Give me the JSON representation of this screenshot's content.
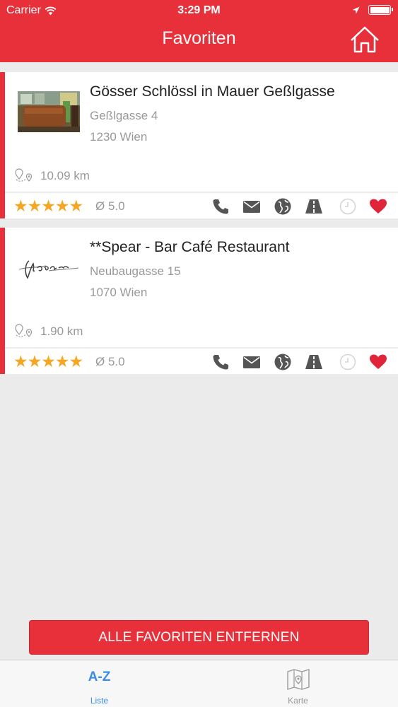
{
  "status_bar": {
    "carrier": "Carrier",
    "time": "3:29 PM"
  },
  "nav": {
    "title": "Favoriten",
    "home_icon": "home-icon"
  },
  "favorites": [
    {
      "name": "Gösser Schlössl in Mauer Geßlgasse",
      "street": "Geßlgasse 4",
      "city": "1230 Wien",
      "distance": "10.09 km",
      "stars": "★★★★★",
      "rating": 5.0,
      "rating_text": "Ø 5.0"
    },
    {
      "name": "**Spear - Bar Café Restaurant",
      "street": "Neubaugasse 15",
      "city": "1070 Wien",
      "distance": "1.90 km",
      "stars": "★★★★★",
      "rating": 5.0,
      "rating_text": "Ø 5.0"
    }
  ],
  "actions": [
    "phone-icon",
    "mail-icon",
    "globe-icon",
    "directions-icon",
    "clock-icon",
    "heart-icon"
  ],
  "remove_button": "ALLE FAVORITEN ENTFERNEN",
  "tabbar": {
    "tabs": [
      {
        "icon_text": "A-Z",
        "label": "Liste",
        "active": true
      },
      {
        "icon": "map-icon",
        "label": "Karte",
        "active": false
      }
    ]
  },
  "colors": {
    "accent": "#e8303a",
    "star": "#f5a623",
    "tab_active": "#3a8ee6",
    "icon_gray": "#555555"
  }
}
